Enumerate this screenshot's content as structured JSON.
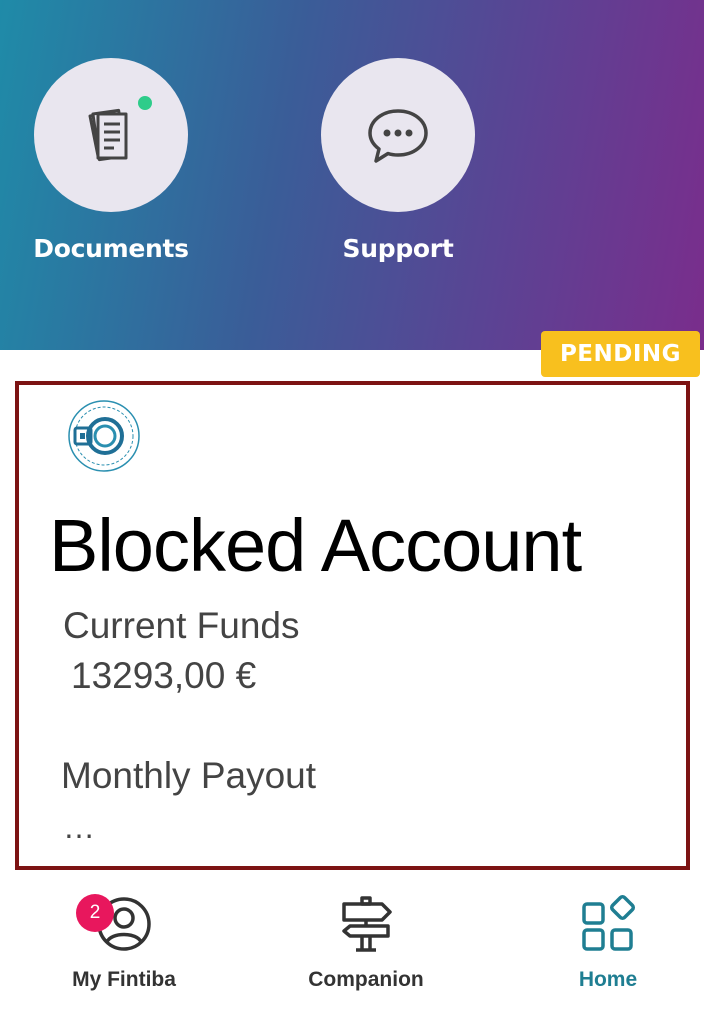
{
  "quick_actions": [
    {
      "label": "Documents",
      "icon": "documents-icon",
      "has_notification_dot": true
    },
    {
      "label": "Support",
      "icon": "chat-bubble-icon"
    }
  ],
  "status_badge": {
    "label": "PENDING",
    "color": "#f8c01e"
  },
  "account_card": {
    "logo": "blocked-account-logo",
    "title": "Blocked Account",
    "funds_label": "Current Funds",
    "funds_value": "13293,00 €",
    "payout_label": "Monthly Payout",
    "payout_value": "…",
    "border_color": "#7c1313"
  },
  "bottom_nav": {
    "items": [
      {
        "label": "My Fintiba",
        "icon": "profile-icon",
        "badge": "2"
      },
      {
        "label": "Companion",
        "icon": "signpost-icon"
      },
      {
        "label": "Home",
        "icon": "home-grid-icon",
        "active": true
      }
    ],
    "active_color": "#1f7e92",
    "badge_color": "#e8175d"
  }
}
